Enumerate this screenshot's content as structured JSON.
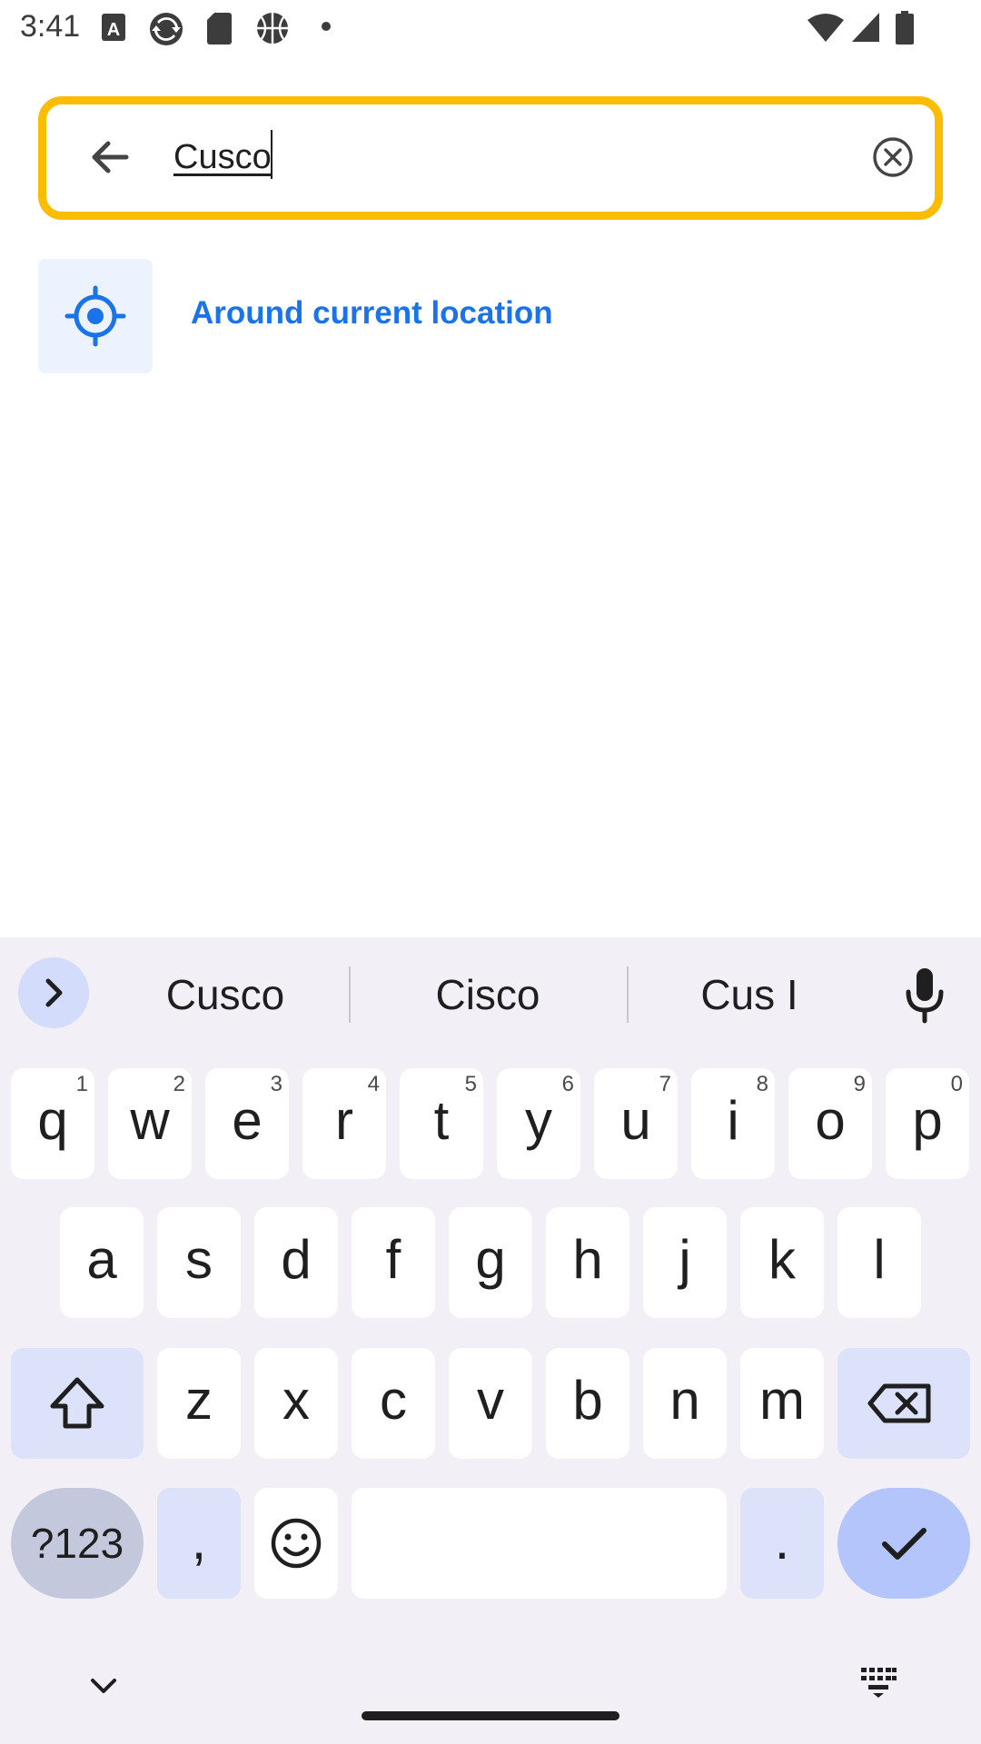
{
  "status_bar": {
    "time": "3:41",
    "left_icons": [
      "font-download-icon",
      "sync-app-icon",
      "sd-card-icon",
      "basketball-icon",
      "dot-icon"
    ],
    "right_icons": [
      "wifi-icon",
      "cell-signal-icon",
      "battery-icon"
    ]
  },
  "search": {
    "back_icon": "arrow-back-icon",
    "value": "Cusco",
    "clear_icon": "clear-circle-icon",
    "border_color": "#fbbc04"
  },
  "suggestion": {
    "label": "Around current location",
    "icon": "my-location-icon",
    "label_color": "#1a73e8",
    "icon_bg": "#ecf3fe"
  },
  "keyboard": {
    "suggestions": [
      "Cusco",
      "Cisco",
      "Cus I"
    ],
    "expand_icon": "chevron-right-icon",
    "mic_icon": "mic-icon",
    "row1": [
      {
        "key": "q",
        "num": "1"
      },
      {
        "key": "w",
        "num": "2"
      },
      {
        "key": "e",
        "num": "3"
      },
      {
        "key": "r",
        "num": "4"
      },
      {
        "key": "t",
        "num": "5"
      },
      {
        "key": "y",
        "num": "6"
      },
      {
        "key": "u",
        "num": "7"
      },
      {
        "key": "i",
        "num": "8"
      },
      {
        "key": "o",
        "num": "9"
      },
      {
        "key": "p",
        "num": "0"
      }
    ],
    "row2": [
      "a",
      "s",
      "d",
      "f",
      "g",
      "h",
      "j",
      "k",
      "l"
    ],
    "row3": [
      "z",
      "x",
      "c",
      "v",
      "b",
      "n",
      "m"
    ],
    "shift_icon": "shift-icon",
    "backspace_icon": "backspace-icon",
    "symbols_label": "?123",
    "comma_label": ",",
    "emoji_icon": "emoji-icon",
    "period_label": ".",
    "enter_icon": "check-icon",
    "nav_down_icon": "chevron-down-icon",
    "keyboard_switch_icon": "keyboard-icon"
  }
}
